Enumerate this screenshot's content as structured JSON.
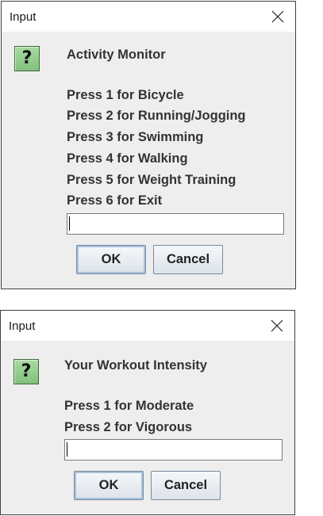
{
  "dialogs": [
    {
      "title": "Input",
      "icon": "question-icon",
      "icon_glyph": "?",
      "lines": [
        "Activity Monitor",
        "Press 1 for Bicycle",
        "Press 2 for Running/Jogging",
        "Press 3 for Swimming",
        "Press 4 for Walking",
        "Press 5 for Weight Training",
        "Press 6 for Exit"
      ],
      "input_value": "",
      "ok_label": "OK",
      "cancel_label": "Cancel"
    },
    {
      "title": "Input",
      "icon": "question-icon",
      "icon_glyph": "?",
      "lines": [
        "Your Workout Intensity",
        "Press 1 for Moderate",
        "Press 2 for Vigorous"
      ],
      "input_value": "",
      "ok_label": "OK",
      "cancel_label": "Cancel"
    }
  ],
  "colors": {
    "dialog_bg": "#eeeeee",
    "titlebar_bg": "#ffffff",
    "icon_green": "#82c07c"
  }
}
